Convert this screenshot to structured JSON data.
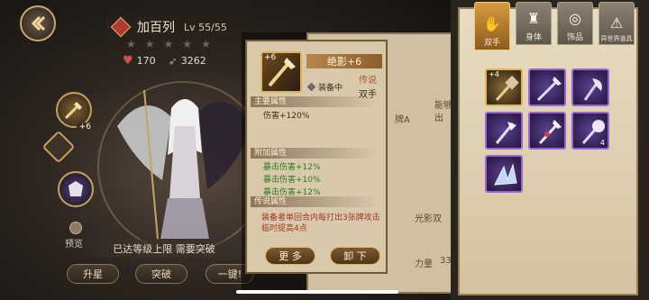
{
  "hero": {
    "name": "加百列",
    "level": "Lv 55/55",
    "hp": "170",
    "speed": "3262",
    "star_count": 5,
    "equip_slot_plus": "+6",
    "preview_label": "预览",
    "limit_text": "已达等级上限 需要突破",
    "buttons": {
      "star_up": "升星",
      "breakthrough": "突破",
      "one_key": "一键!"
    }
  },
  "background_fragments": {
    "f1": "能够",
    "f2": "出",
    "f3": "牌A",
    "f4": "光影双",
    "f5": "力量",
    "f6": "33"
  },
  "item": {
    "plus": "+6",
    "name": "绝影+6",
    "rarity": "传说",
    "type": "双手",
    "equipped": "装备中",
    "main_attr_title": "主要属性",
    "main_attr": "伤害+120%",
    "extra_attr_title": "附加属性",
    "extra_attrs": [
      "暴击伤害+12%",
      "暴击伤害+10%",
      "暴击伤害+12%"
    ],
    "legend_attr_title": "传说属性",
    "legend_attr": "装备者单回合内每打出3张牌攻击临时提高4点",
    "btn_more": "更 多",
    "btn_unequip": "卸 下"
  },
  "inventory": {
    "tabs": [
      {
        "label": "双手",
        "icon": "hand-icon",
        "active": true
      },
      {
        "label": "身体",
        "icon": "armor-icon",
        "active": false
      },
      {
        "label": "饰品",
        "icon": "accessory-icon",
        "active": false
      },
      {
        "label": "异世界道具",
        "icon": "otherworld-icon",
        "active": false
      }
    ],
    "items": [
      {
        "icon": "warhammer-icon",
        "rarity": "gold",
        "top_left": "+4",
        "bottom_right": ""
      },
      {
        "icon": "spear-icon",
        "rarity": "purple",
        "top_left": "",
        "bottom_right": ""
      },
      {
        "icon": "axe-icon",
        "rarity": "purple",
        "top_left": "",
        "bottom_right": ""
      },
      {
        "icon": "halberd-icon",
        "rarity": "purple",
        "top_left": "",
        "bottom_right": ""
      },
      {
        "icon": "lance-icon",
        "rarity": "purple",
        "top_left": "",
        "bottom_right": ""
      },
      {
        "icon": "mace-icon",
        "rarity": "purple",
        "top_left": "",
        "bottom_right": "4"
      },
      {
        "icon": "ice-crystal-icon",
        "rarity": "purple",
        "top_left": "",
        "bottom_right": ""
      }
    ]
  },
  "colors": {
    "gold_frame": "#e2b455",
    "purple_frame": "#9d62d6",
    "legend_text": "#a53525",
    "extra_text": "#2c7a1f"
  }
}
